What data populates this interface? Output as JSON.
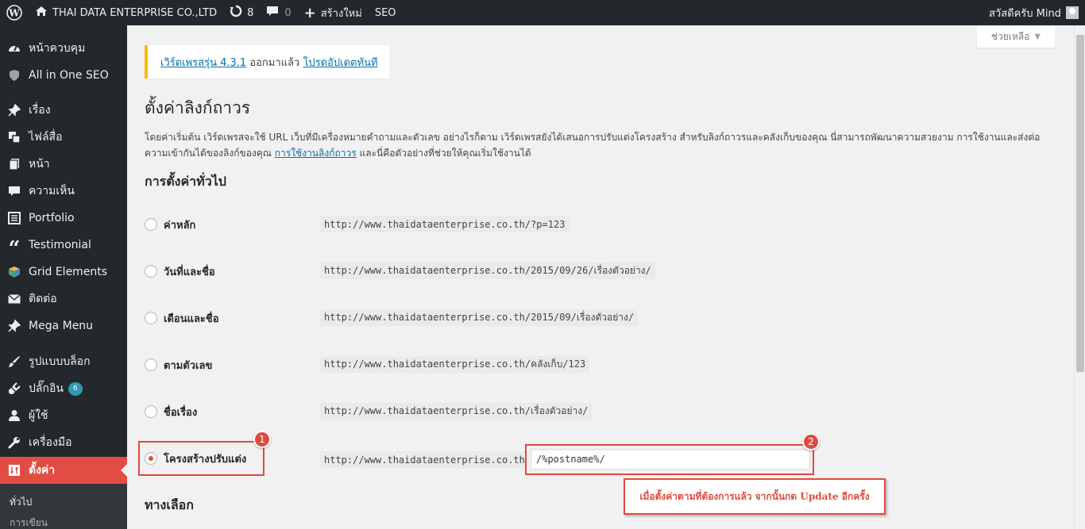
{
  "adminbar": {
    "site_name": "THAI DATA ENTERPRISE CO.,LTD",
    "updates_count": "8",
    "comments_count": "0",
    "new_label": "สร้างใหม่",
    "seo_label": "SEO",
    "greeting": "สวัสดีครับ Mind"
  },
  "sidebar": {
    "items": [
      {
        "label": "หน้าควบคุม",
        "icon": "dashboard-icon"
      },
      {
        "label": "All in One SEO",
        "icon": "shield-icon"
      },
      {
        "label": "เรื่อง",
        "icon": "pin-icon"
      },
      {
        "label": "ไฟล์สื่อ",
        "icon": "media-icon"
      },
      {
        "label": "หน้า",
        "icon": "page-icon"
      },
      {
        "label": "ความเห็น",
        "icon": "comment-icon"
      },
      {
        "label": "Portfolio",
        "icon": "list-icon"
      },
      {
        "label": "Testimonial",
        "icon": "quote-icon"
      },
      {
        "label": "Grid Elements",
        "icon": "grid-icon"
      },
      {
        "label": "ติดต่อ",
        "icon": "mail-icon"
      },
      {
        "label": "Mega Menu",
        "icon": "pin-icon"
      },
      {
        "label": "รูปแบบบล็อก",
        "icon": "brush-icon"
      },
      {
        "label": "ปลั๊กอิน",
        "icon": "plugin-icon",
        "badge": "6"
      },
      {
        "label": "ผู้ใช้",
        "icon": "user-icon"
      },
      {
        "label": "เครื่องมือ",
        "icon": "wrench-icon"
      },
      {
        "label": "ตั้งค่า",
        "icon": "settings-icon"
      }
    ],
    "submenu": [
      "ทั่วไป",
      "การเขียน"
    ]
  },
  "help_tab": "ช่วยเหลือ",
  "notice": {
    "link1": "เวิร์ดเพรสรุ่น 4.3.1",
    "mid": " ออกมาแล้ว ",
    "link2": "โปรดอัปเดตทันที"
  },
  "page_title": "ตั้งค่าลิงก์ถาวร",
  "description": {
    "line1": "โดยค่าเริ่มต้น เวิร์ดเพรสจะใช้ URL เว็บที่มีเครื่องหมายคำถามและตัวเลข อย่างไรก็ตาม เวิร์ดเพรสยังได้เสนอการปรับแต่งโครงสร้าง สำหรับลิงก์ถาวรและคลังเก็บของคุณ นี่สามารถพัฒนาความสวยงาม การใช้งานและส่งต่อ",
    "line2_pre": "ความเข้ากันได้ของลิงก์ของคุณ ",
    "line2_link": "การใช้งานลิงก์ถาวร",
    "line2_post": " และนี่คือตัวอย่างที่ช่วยให้คุณเริ่มใช้งานได้"
  },
  "general_section_title": "การตั้งค่าทั่วไป",
  "options": [
    {
      "label": "ค่าหลัก",
      "example": "http://www.thaidataenterprise.co.th/?p=123",
      "checked": false
    },
    {
      "label": "วันที่และชื่อ",
      "example": "http://www.thaidataenterprise.co.th/2015/09/26/เรื่องตัวอย่าง/",
      "checked": false
    },
    {
      "label": "เดือนและชื่อ",
      "example": "http://www.thaidataenterprise.co.th/2015/09/เรื่องตัวอย่าง/",
      "checked": false
    },
    {
      "label": "ตามตัวเลข",
      "example": "http://www.thaidataenterprise.co.th/คลังเก็บ/123",
      "checked": false
    },
    {
      "label": "ชื่อเรื่อง",
      "example": "http://www.thaidataenterprise.co.th/เรื่องตัวอย่าง/",
      "checked": false
    },
    {
      "label": "โครงสร้างปรับแต่ง",
      "example": "http://www.thaidataenterprise.co.th",
      "checked": true
    }
  ],
  "custom_structure_value": "/%postname%/",
  "options_section_title": "ทางเลือก",
  "callouts": {
    "num1": "1",
    "num2": "2",
    "note": "เมื่อตั้งค่าตามที่ต้องการแล้ว จากนั้นกด Update อีกครั้ง"
  },
  "colors": {
    "adminbar_bg": "#23282d",
    "active_menu": "#e14d43",
    "link": "#0073aa",
    "notice_border": "#ffba00",
    "callout": "#e04a3f"
  }
}
